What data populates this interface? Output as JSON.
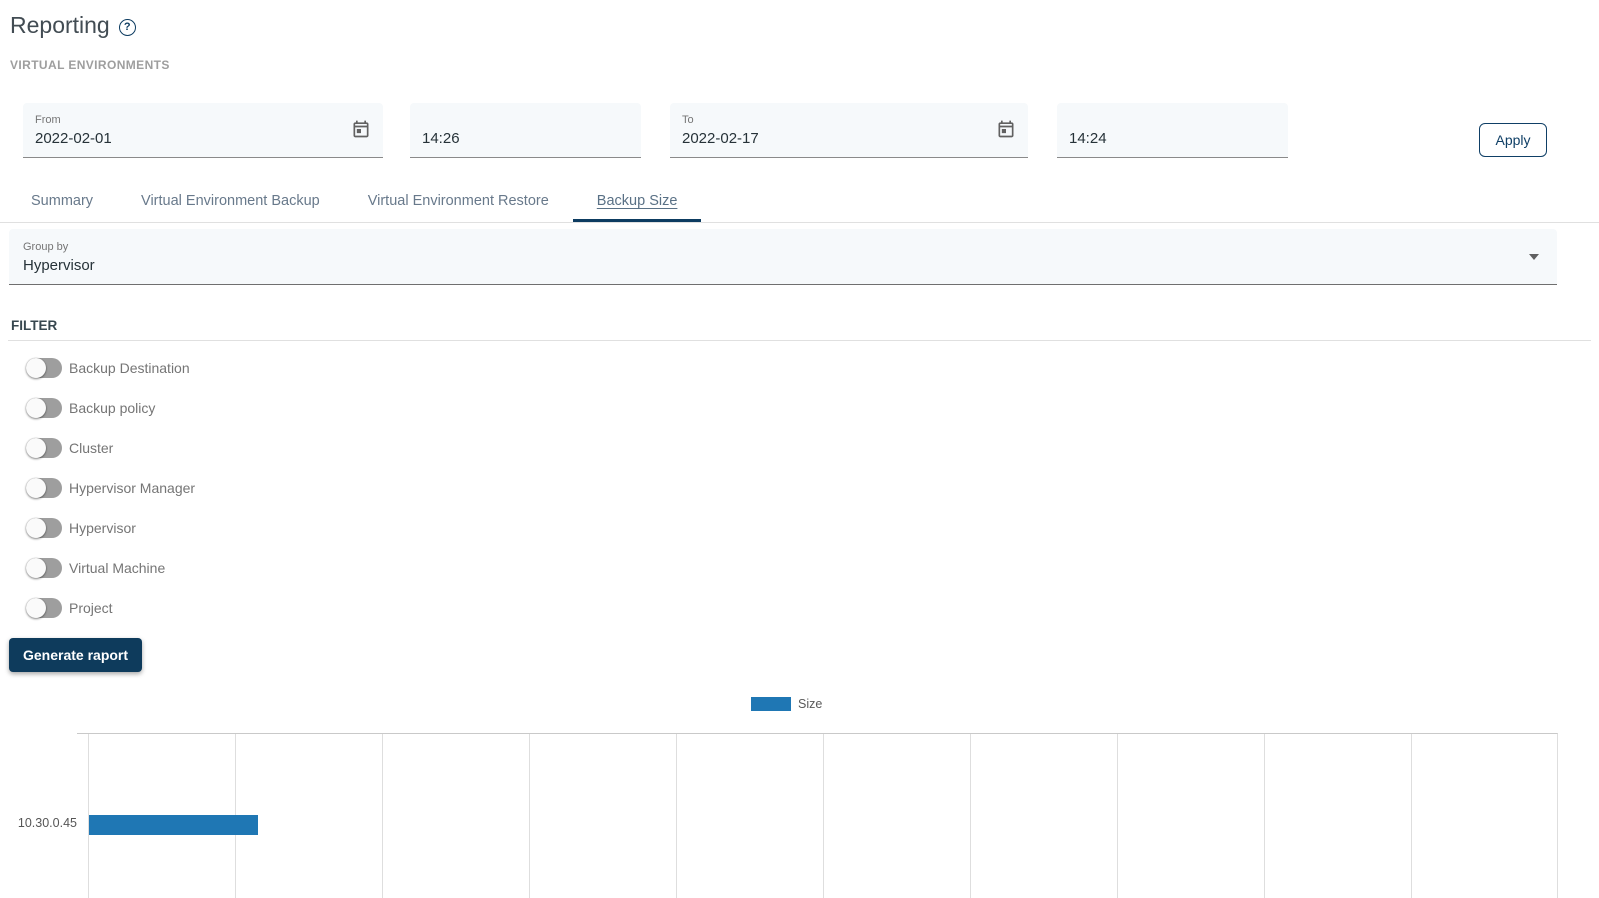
{
  "page": {
    "title": "Reporting",
    "help_icon_glyph": "?",
    "subtitle": "VIRTUAL ENVIRONMENTS"
  },
  "date_range": {
    "from": {
      "label": "From",
      "value": "2022-02-01"
    },
    "from_time": {
      "value": "14:26"
    },
    "to": {
      "label": "To",
      "value": "2022-02-17"
    },
    "to_time": {
      "value": "14:24"
    },
    "apply_label": "Apply"
  },
  "tabs": {
    "items": [
      {
        "label": "Summary",
        "active": false
      },
      {
        "label": "Virtual Environment Backup",
        "active": false
      },
      {
        "label": "Virtual Environment Restore",
        "active": false
      },
      {
        "label": "Backup Size",
        "active": true
      }
    ]
  },
  "group_by": {
    "label": "Group by",
    "value": "Hypervisor"
  },
  "filter": {
    "heading": "FILTER",
    "items": [
      {
        "label": "Backup Destination",
        "enabled": false
      },
      {
        "label": "Backup policy",
        "enabled": false
      },
      {
        "label": "Cluster",
        "enabled": false
      },
      {
        "label": "Hypervisor Manager",
        "enabled": false
      },
      {
        "label": "Hypervisor",
        "enabled": false
      },
      {
        "label": "Virtual Machine",
        "enabled": false
      },
      {
        "label": "Project",
        "enabled": false
      }
    ],
    "generate_button_label": "Generate raport"
  },
  "colors": {
    "accent_navy": "#0d3c61",
    "bar_blue": "#1f77b4",
    "field_bg": "#f6f9fb",
    "divider": "#e0e0e0",
    "muted_text": "#757575"
  },
  "chart_data": {
    "type": "bar",
    "orientation": "horizontal",
    "title": "",
    "categories": [
      "10.30.0.45"
    ],
    "series": [
      {
        "name": "Size",
        "color": "#1f77b4",
        "values_fraction_of_axis": [
          0.115
        ]
      }
    ],
    "legend": {
      "position": "top",
      "entries": [
        "Size"
      ]
    },
    "x_axis": {
      "tick_labels_visible": false,
      "gridline_count": 11
    },
    "notes": "Single horizontal bar; value-axis tick labels are cut off below the visible area. Bar length is about 1.15 gridline intervals (~11.5% of the plotted axis width)."
  }
}
